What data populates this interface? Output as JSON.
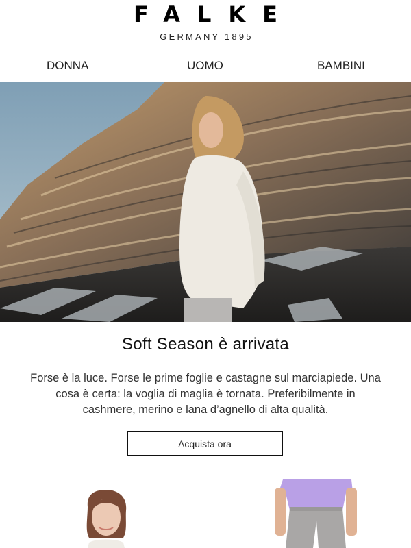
{
  "header": {
    "brand": "FALKE",
    "tagline": "GERMANY 1895"
  },
  "nav": {
    "items": [
      "DONNA",
      "UOMO",
      "BAMBINI"
    ]
  },
  "hero": {
    "image": "woman-in-white-sweater-on-rocky-coast"
  },
  "content": {
    "headline": "Soft Season è arrivata",
    "body_lines": [
      "Forse è la luce. Forse le prime foglie e castagne sul marciapiede. Una",
      "cosa è certa: la voglia di maglia è tornata. Preferibilmente in",
      "cashmere, merino e lana d’agnello di alta qualità."
    ],
    "cta_label": "Acquista ora"
  },
  "products": {
    "left_image": "model-portrait",
    "right_image": "model-lilac-top-grey-pants"
  },
  "colors": {
    "text": "#111111",
    "cta_border": "#111111",
    "background": "#ffffff"
  }
}
